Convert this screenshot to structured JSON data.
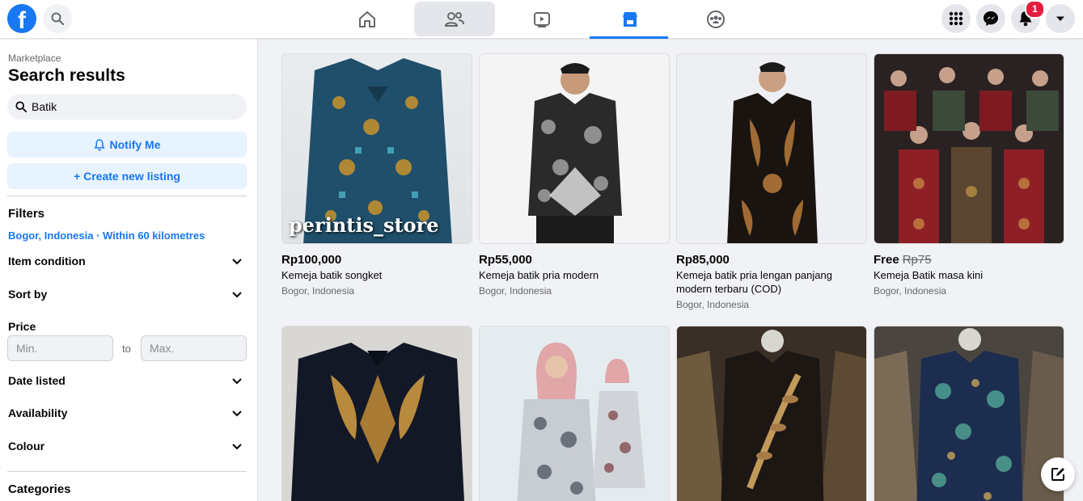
{
  "nav": {
    "logo_icon": "facebook-logo",
    "tabs": [
      {
        "name": "home",
        "icon": "home-icon"
      },
      {
        "name": "friends",
        "icon": "friends-icon"
      },
      {
        "name": "watch",
        "icon": "video-icon"
      },
      {
        "name": "marketplace",
        "icon": "marketplace-icon",
        "active": true
      },
      {
        "name": "groups",
        "icon": "groups-icon"
      }
    ],
    "notification_count": "1",
    "brand_color": "#1877f2"
  },
  "sidebar": {
    "breadcrumb": "Marketplace",
    "title": "Search results",
    "search_value": "Batik",
    "notify_label": "Notify Me",
    "create_label": "+ Create new listing",
    "filters_heading": "Filters",
    "location": "Bogor, Indonesia · Within 60 kilometres",
    "item_condition": "Item condition",
    "sort_by": "Sort by",
    "price_label": "Price",
    "price_min_placeholder": "Min.",
    "price_to": "to",
    "price_max_placeholder": "Max.",
    "date_listed": "Date listed",
    "availability": "Availability",
    "colour": "Colour",
    "categories": "Categories"
  },
  "listings": [
    {
      "price": "Rp100,000",
      "old_price": "",
      "title": "Kemeja batik songket",
      "location": "Bogor, Indonesia",
      "watermark": "perintis_store"
    },
    {
      "price": "Rp55,000",
      "old_price": "",
      "title": "Kemeja batik pria modern",
      "location": "Bogor, Indonesia"
    },
    {
      "price": "Rp85,000",
      "old_price": "",
      "title": "Kemeja batik pria lengan panjang modern terbaru (COD)",
      "location": "Bogor, Indonesia"
    },
    {
      "price": "Free",
      "old_price": "Rp75",
      "title": "Kemeja Batik masa kini",
      "location": "Bogor, Indonesia"
    },
    {
      "price": "",
      "old_price": "",
      "title": "",
      "location": ""
    },
    {
      "price": "",
      "old_price": "",
      "title": "",
      "location": ""
    },
    {
      "price": "",
      "old_price": "",
      "title": "",
      "location": ""
    },
    {
      "price": "",
      "old_price": "",
      "title": "",
      "location": ""
    }
  ]
}
